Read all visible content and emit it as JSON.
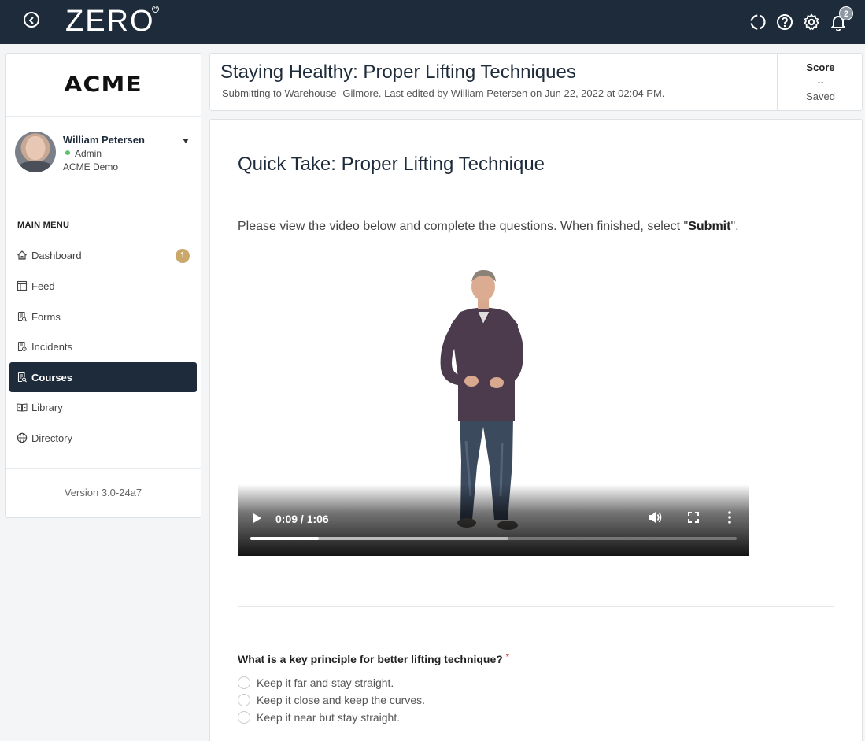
{
  "topbar": {
    "logo_text": "ZERO",
    "logo_mark": "R",
    "notification_count": "2",
    "icons": [
      "back-icon",
      "sync-icon",
      "help-icon",
      "settings-icon",
      "bell-icon"
    ]
  },
  "sidebar": {
    "company_logo": "ACME",
    "user": {
      "name": "William Petersen",
      "role": "Admin",
      "organization": "ACME Demo",
      "status_color": "#5cc36b"
    },
    "menu_title": "MAIN MENU",
    "items": [
      {
        "label": "Dashboard",
        "icon": "home-icon",
        "badge": "1"
      },
      {
        "label": "Feed",
        "icon": "feed-icon"
      },
      {
        "label": "Forms",
        "icon": "forms-icon"
      },
      {
        "label": "Incidents",
        "icon": "incidents-icon"
      },
      {
        "label": "Courses",
        "icon": "courses-icon",
        "active": true
      },
      {
        "label": "Library",
        "icon": "library-icon"
      },
      {
        "label": "Directory",
        "icon": "globe-icon"
      }
    ],
    "version": "Version 3.0-24a7"
  },
  "header": {
    "title": "Staying Healthy: Proper Lifting Techniques",
    "subtitle": "Submitting to Warehouse- Gilmore. Last edited by William Petersen on Jun 22, 2022 at 02:04 PM.",
    "score_label": "Score",
    "score_value": "--",
    "score_status": "Saved"
  },
  "content": {
    "section_title": "Quick Take: Proper Lifting Technique",
    "instructions_prefix": "Please view the video below and complete the questions. When finished, select \"",
    "instructions_bold": "Submit",
    "instructions_suffix": "\".",
    "video": {
      "time": "0:09 / 1:06",
      "progress": 0.14,
      "buffered": 0.53
    },
    "question": "What is a key principle for better lifting technique?",
    "required_mark": "*",
    "options": [
      "Keep it far and stay straight.",
      "Keep it close and keep the curves.",
      "Keep it near but stay straight."
    ]
  },
  "colors": {
    "topbar": "#1d2b3a",
    "active_menu": "#1d2b3a",
    "badge": "#c9a86a"
  }
}
